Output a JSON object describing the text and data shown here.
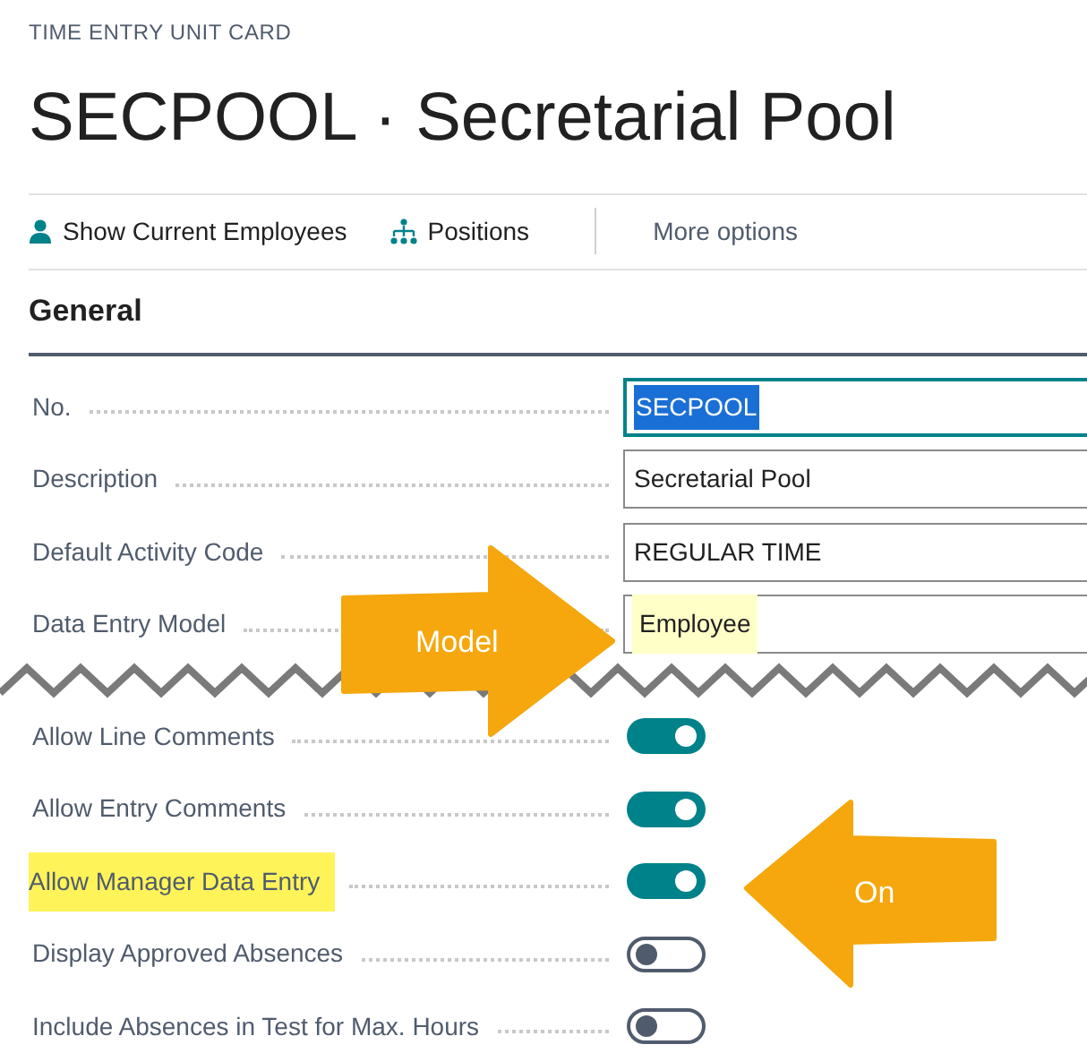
{
  "page": {
    "caption": "TIME ENTRY UNIT CARD",
    "title": "SECPOOL · Secretarial Pool"
  },
  "actions": [
    {
      "label": "Show Current Employees",
      "kind": "person"
    },
    {
      "label": "Positions",
      "kind": "hierarchy"
    },
    {
      "label": "More options",
      "kind": "more"
    }
  ],
  "section": {
    "title": "General"
  },
  "fields": [
    {
      "kind": "text",
      "label": "No.",
      "value": "SECPOOL",
      "selected": true,
      "highlighted": false
    },
    {
      "kind": "text",
      "label": "Description",
      "value": "Secretarial Pool",
      "selected": false,
      "highlighted": false
    },
    {
      "kind": "text",
      "label": "Default Activity Code",
      "value": "REGULAR TIME",
      "selected": false,
      "highlighted": false
    },
    {
      "kind": "text",
      "label": "Data Entry Model",
      "value": "Employee",
      "selected": false,
      "highlighted": true
    },
    {
      "kind": "tear"
    },
    {
      "kind": "toggle",
      "label": "Allow Line Comments",
      "on": true,
      "highlighted": false
    },
    {
      "kind": "toggle",
      "label": "Allow Entry Comments",
      "on": true,
      "highlighted": false
    },
    {
      "kind": "toggle",
      "label": "Allow Manager Data Entry",
      "on": true,
      "highlighted": true
    },
    {
      "kind": "toggle",
      "label": "Display Approved Absences",
      "on": false,
      "highlighted": false
    },
    {
      "kind": "toggle",
      "label": "Include Absences in Test for Max. Hours",
      "on": false,
      "highlighted": false
    }
  ],
  "callouts": [
    {
      "text": "Model",
      "kind": "right_arrow"
    },
    {
      "text": "On",
      "kind": "left_arrow"
    }
  ]
}
